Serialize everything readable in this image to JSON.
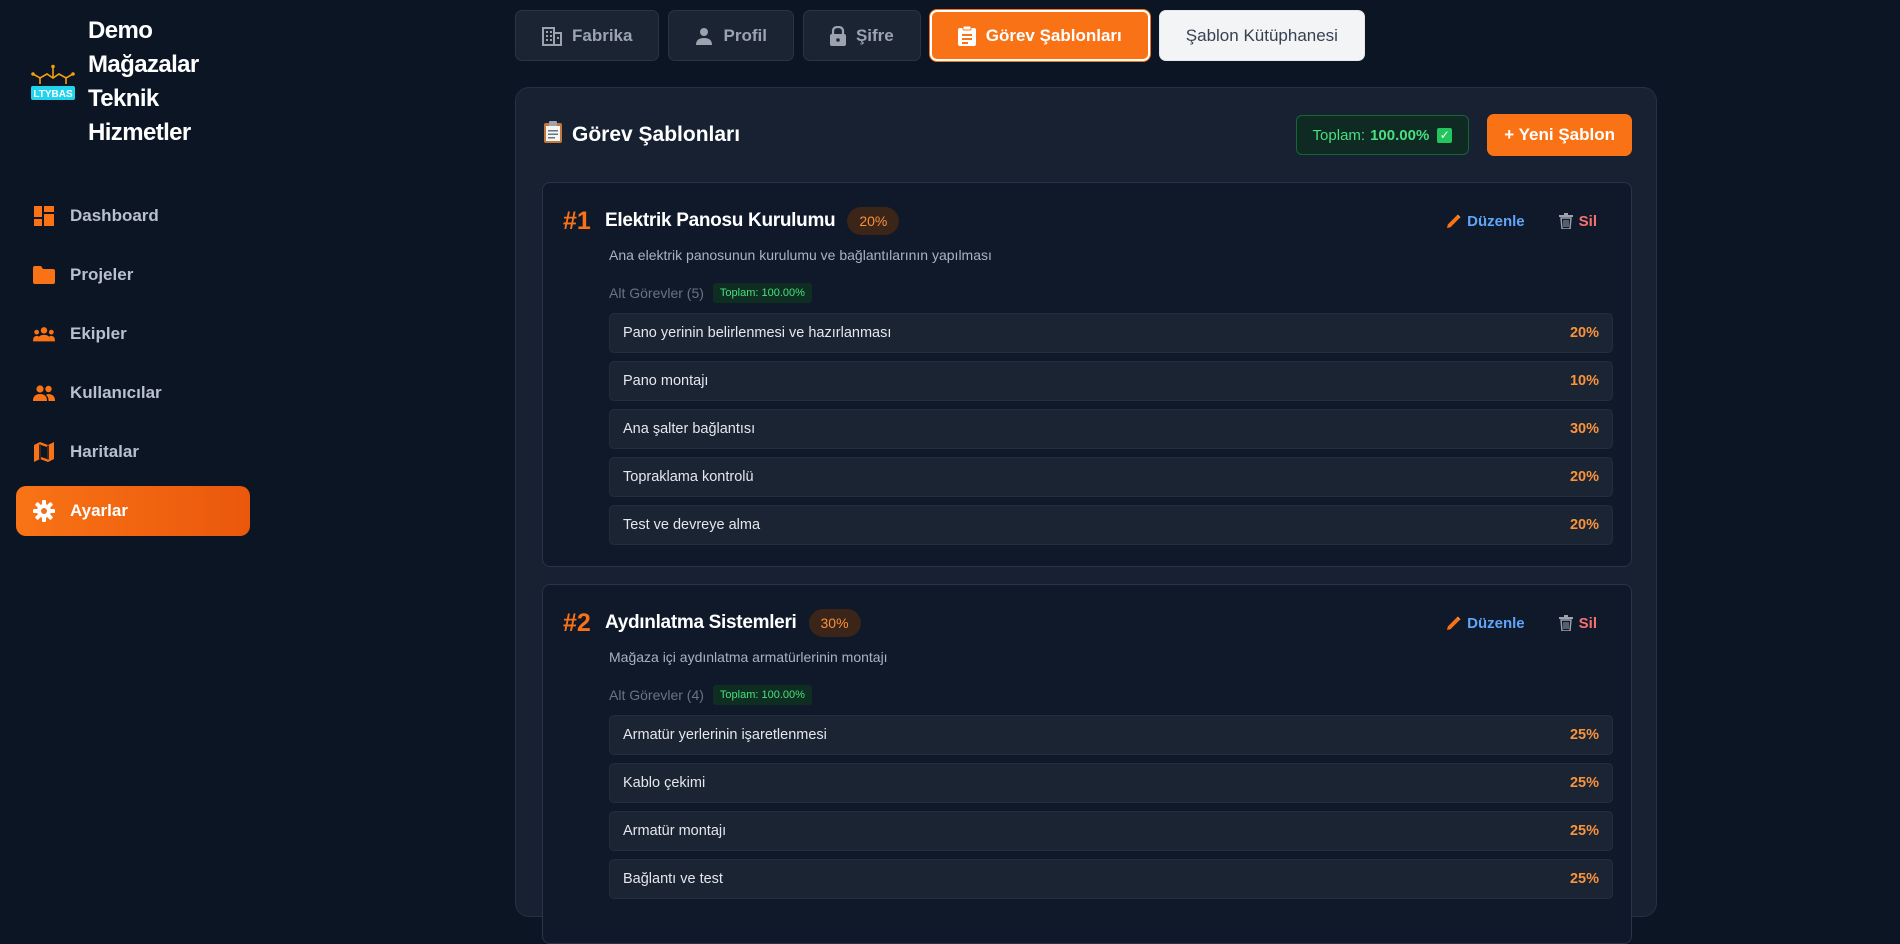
{
  "brand": {
    "title": "Demo Mağazalar Teknik Hizmetler",
    "logo_text": "LTYBAS"
  },
  "sidebar": {
    "items": [
      {
        "label": "Dashboard",
        "icon": "dashboard-icon"
      },
      {
        "label": "Projeler",
        "icon": "folder-icon"
      },
      {
        "label": "Ekipler",
        "icon": "teams-icon"
      },
      {
        "label": "Kullanıcılar",
        "icon": "users-icon"
      },
      {
        "label": "Haritalar",
        "icon": "map-icon"
      },
      {
        "label": "Ayarlar",
        "icon": "gear-icon",
        "active": true
      }
    ]
  },
  "tabs": [
    {
      "label": "Fabrika",
      "icon": "building-icon"
    },
    {
      "label": "Profil",
      "icon": "person-icon"
    },
    {
      "label": "Şifre",
      "icon": "lock-icon"
    },
    {
      "label": "Görev Şablonları",
      "icon": "clipboard-icon",
      "active": true
    },
    {
      "label": "Şablon Kütüphanesi"
    }
  ],
  "panel": {
    "title": "Görev Şablonları",
    "total_label": "Toplam:",
    "total_value": "100.00%",
    "new_button": "+ Yeni Şablon"
  },
  "templates": [
    {
      "num": "#1",
      "title": "Elektrik Panosu Kurulumu",
      "percent": "20%",
      "description": "Ana elektrik panosunun kurulumu ve bağlantılarının yapılması",
      "sub_count": "Alt Görevler (5)",
      "sub_total": "Toplam: 100.00%",
      "edit": "Düzenle",
      "delete": "Sil",
      "subtasks": [
        {
          "name": "Pano yerinin belirlenmesi ve hazırlanması",
          "value": "20%"
        },
        {
          "name": "Pano montajı",
          "value": "10%"
        },
        {
          "name": "Ana şalter bağlantısı",
          "value": "30%"
        },
        {
          "name": "Topraklama kontrolü",
          "value": "20%"
        },
        {
          "name": "Test ve devreye alma",
          "value": "20%"
        }
      ]
    },
    {
      "num": "#2",
      "title": "Aydınlatma Sistemleri",
      "percent": "30%",
      "description": "Mağaza içi aydınlatma armatürlerinin montajı",
      "sub_count": "Alt Görevler (4)",
      "sub_total": "Toplam: 100.00%",
      "edit": "Düzenle",
      "delete": "Sil",
      "subtasks": [
        {
          "name": "Armatür yerlerinin işaretlenmesi",
          "value": "25%"
        },
        {
          "name": "Kablo çekimi",
          "value": "25%"
        },
        {
          "name": "Armatür montajı",
          "value": "25%"
        },
        {
          "name": "Bağlantı ve test",
          "value": "25%"
        }
      ]
    }
  ],
  "colors": {
    "accent": "#f97316",
    "background": "#0c1524",
    "panel": "#172131",
    "success": "#4ade80",
    "edit": "#60a5fa",
    "delete": "#f87171"
  }
}
